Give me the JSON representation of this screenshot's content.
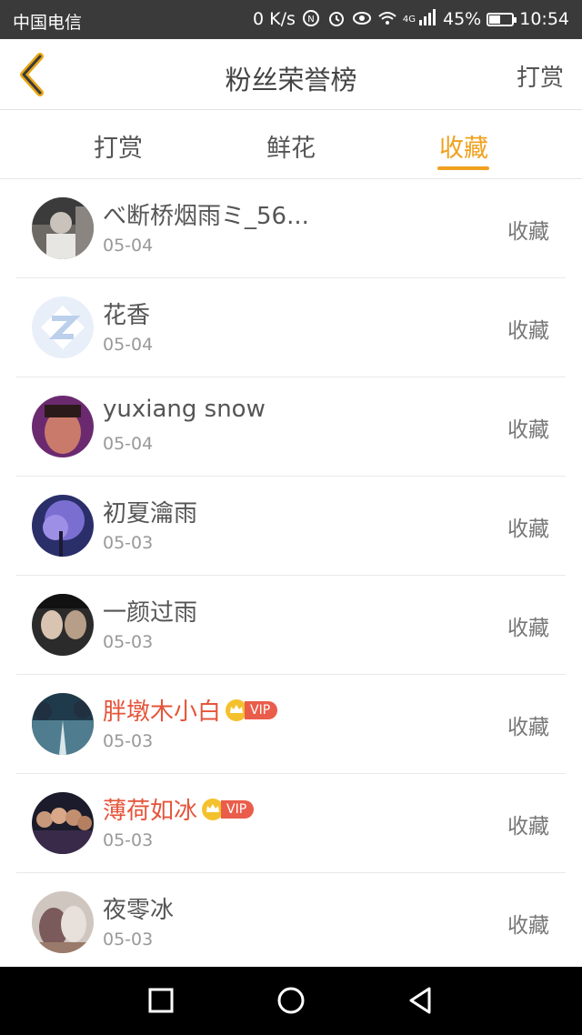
{
  "status_bar": {
    "carrier": "中国电信",
    "speed": "0 K/s",
    "network": "4G",
    "battery": "45%",
    "battery_level": 0.45,
    "time": "10:54"
  },
  "header": {
    "title": "粉丝荣誉榜",
    "action": "打赏"
  },
  "tabs": [
    {
      "label": "打赏",
      "active": false
    },
    {
      "label": "鲜花",
      "active": false
    },
    {
      "label": "收藏",
      "active": true
    }
  ],
  "list": [
    {
      "name": "べ断桥烟雨ミ_56...",
      "date": "05-04",
      "action": "收藏",
      "vip": false
    },
    {
      "name": "花香",
      "date": "05-04",
      "action": "收藏",
      "vip": false
    },
    {
      "name": "yuxiang snow",
      "date": "05-04",
      "action": "收藏",
      "vip": false
    },
    {
      "name": "初夏瀹雨",
      "date": "05-03",
      "action": "收藏",
      "vip": false
    },
    {
      "name": "一颜过雨",
      "date": "05-03",
      "action": "收藏",
      "vip": false
    },
    {
      "name": "胖墩木小白",
      "date": "05-03",
      "action": "收藏",
      "vip": true,
      "badge": "VIP"
    },
    {
      "name": "薄荷如冰",
      "date": "05-03",
      "action": "收藏",
      "vip": true,
      "badge": "VIP"
    },
    {
      "name": "夜零冰",
      "date": "05-03",
      "action": "收藏",
      "vip": false
    }
  ],
  "colors": {
    "accent": "#f0a11f",
    "vip_name": "#e5543a",
    "vip_badge": "#ea5d4a"
  }
}
